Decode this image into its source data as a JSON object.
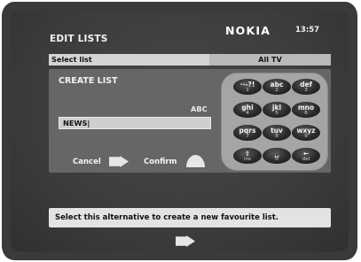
{
  "header": {
    "title": "EDIT LISTS",
    "brand": "NOKIA",
    "clock": "13:57"
  },
  "select_bar": {
    "label": "Select list",
    "value": "All TV"
  },
  "create_panel": {
    "title": "CREATE LIST",
    "input_mode": "ABC",
    "name_value": "NEWS|"
  },
  "buttons": {
    "cancel_label": "Cancel",
    "confirm_label": "Confirm"
  },
  "keypad": {
    "keys": [
      {
        "main": "··-?!",
        "sub": "1"
      },
      {
        "main": "abc",
        "sub": "2"
      },
      {
        "main": "def",
        "sub": "3"
      },
      {
        "main": "ghi",
        "sub": "4"
      },
      {
        "main": "jkl",
        "sub": "5"
      },
      {
        "main": "mno",
        "sub": "6"
      },
      {
        "main": "pqrs",
        "sub": "7"
      },
      {
        "main": "tuv",
        "sub": "8"
      },
      {
        "main": "wxyz",
        "sub": "9"
      },
      {
        "main": "⇧",
        "sub": "ins"
      },
      {
        "main": "␣",
        "sub": "0"
      },
      {
        "main": "←",
        "sub": "del"
      }
    ]
  },
  "help": {
    "text": "Select this alternative to create a new favourite list."
  },
  "colors": {
    "screen_bg": "#3c3c3c",
    "panel_bg": "#666666",
    "keypad_bg": "#a5a5a5",
    "help_bg": "#e3e3e3"
  },
  "icons": {
    "cancel": "right-arrow-icon",
    "confirm": "hill-icon",
    "next": "right-arrow-icon"
  }
}
